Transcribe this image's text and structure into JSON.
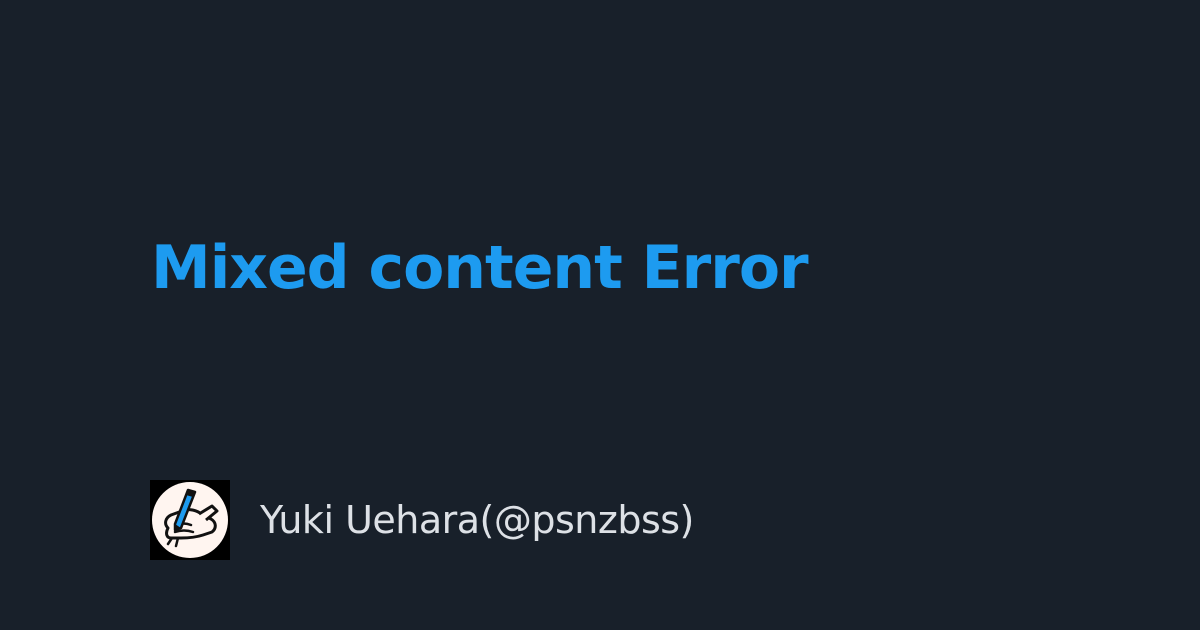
{
  "post": {
    "title": "Mixed content Error"
  },
  "author": {
    "display": "Yuki Uehara(@psnzbss)",
    "avatar_icon": "hand-writing-pencil-icon"
  },
  "colors": {
    "background": "#18202a",
    "title": "#1d9bf0",
    "author_text": "#dde1e6",
    "avatar_background": "#000000",
    "avatar_circle": "#fff5f0",
    "avatar_pencil": "#1d9bf0"
  }
}
